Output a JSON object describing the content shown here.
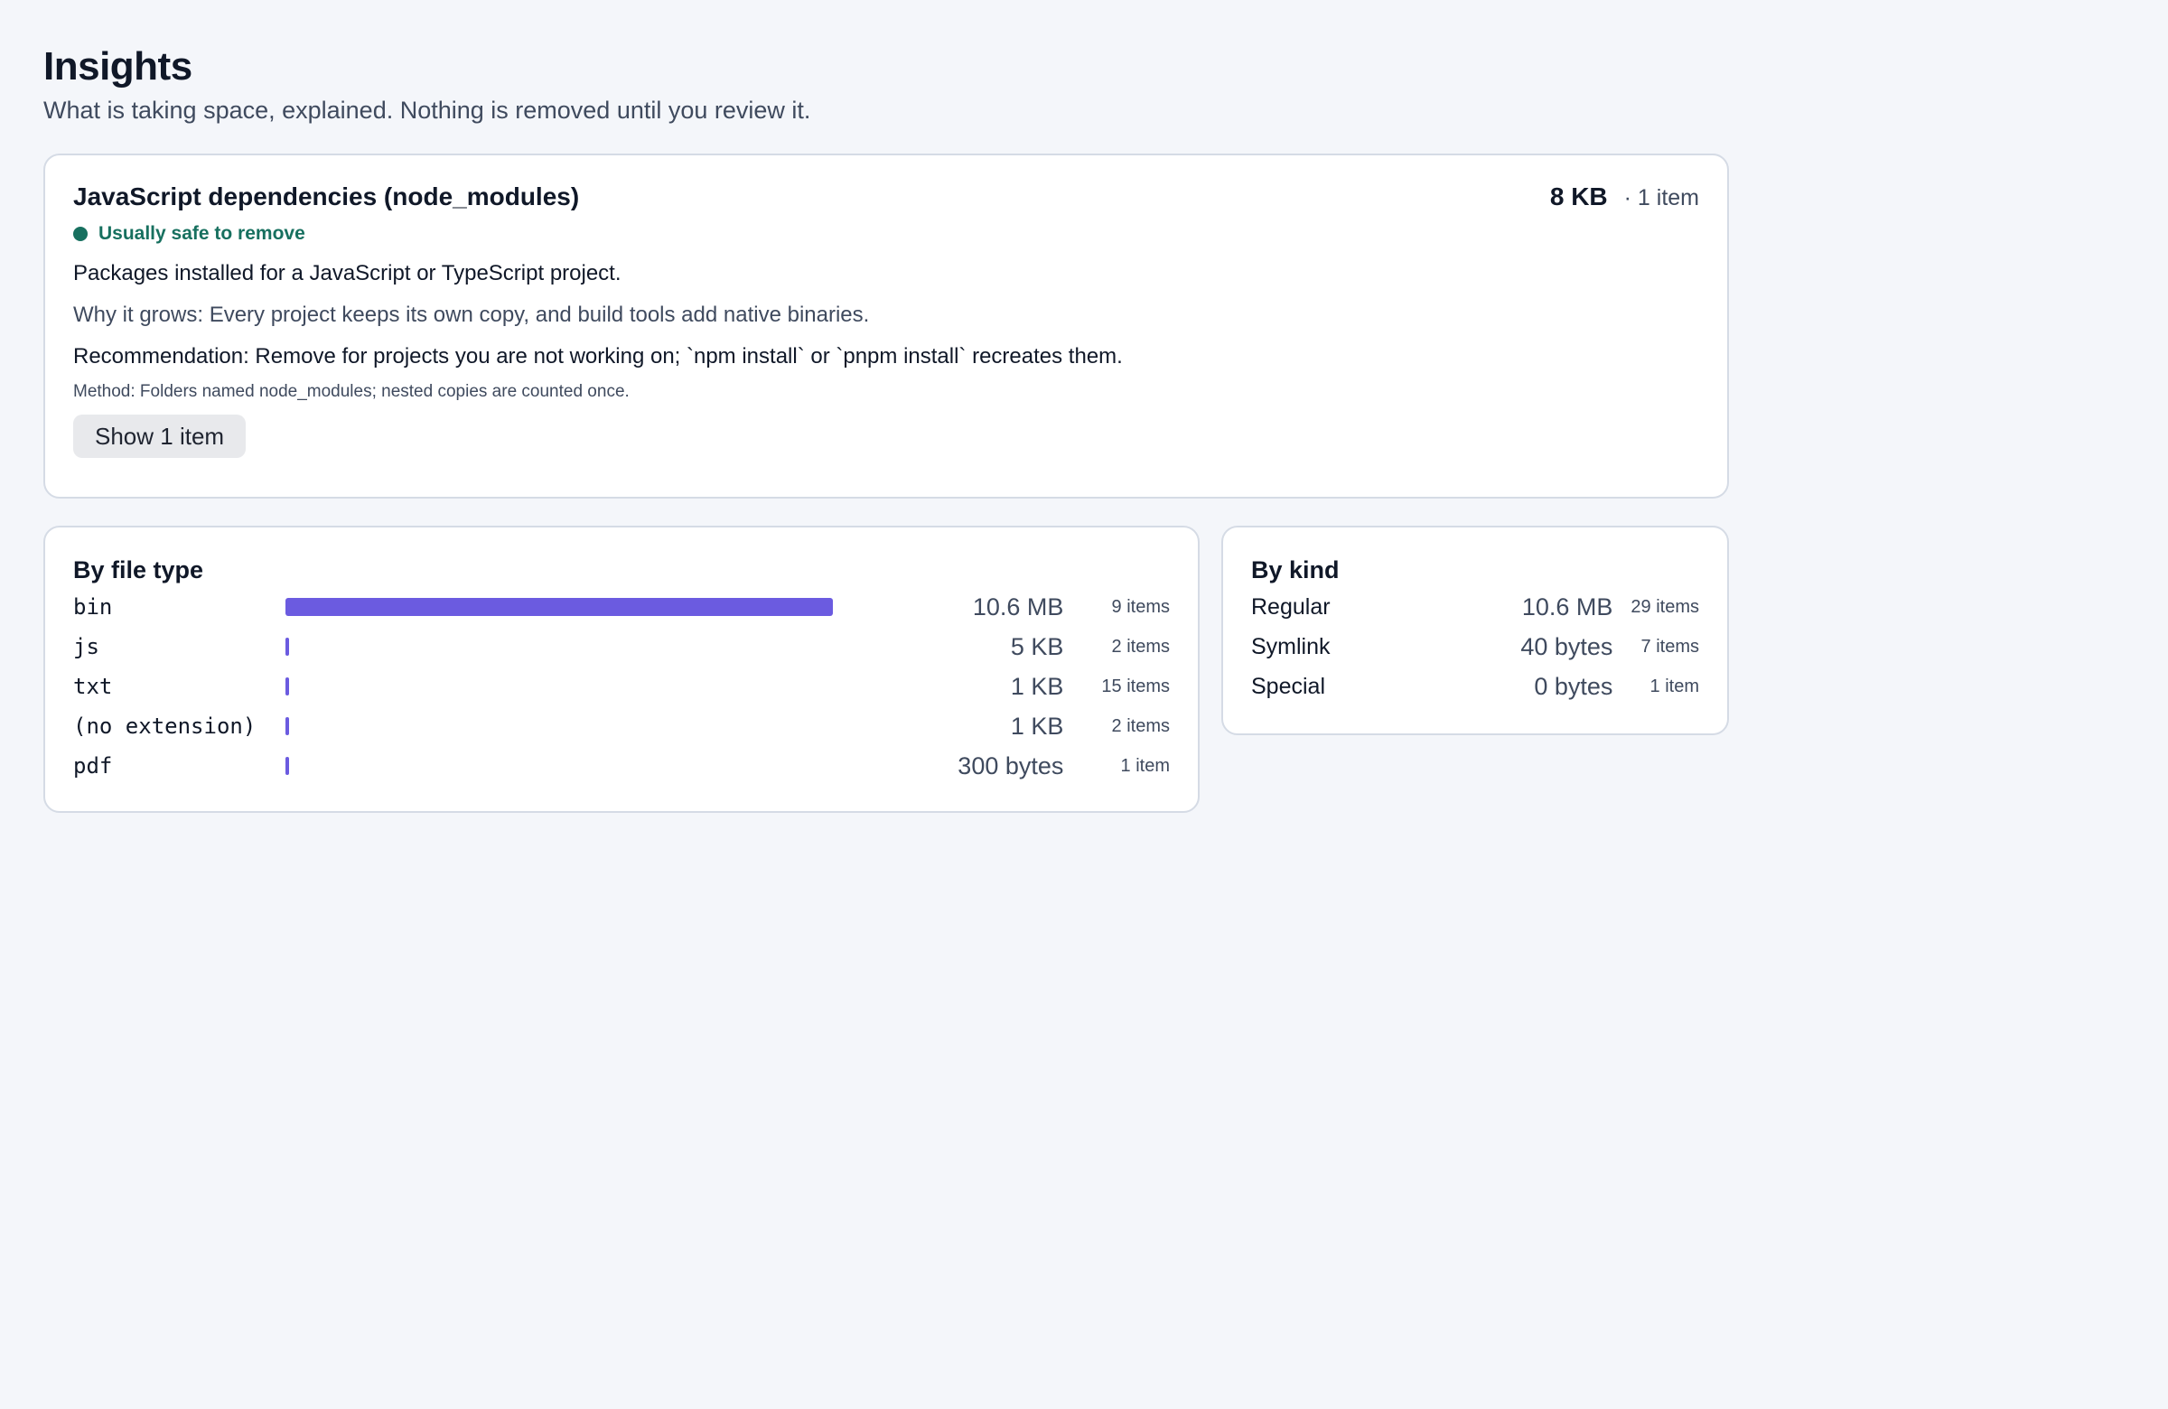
{
  "header": {
    "title": "Insights",
    "subtitle": "What is taking space, explained. Nothing is removed until you review it."
  },
  "insight": {
    "title": "JavaScript dependencies (node_modules)",
    "size": "8 KB",
    "count": "· 1 item",
    "safety": "Usually safe to remove",
    "safety_color": "#17705f",
    "description": "Packages installed for a JavaScript or TypeScript project.",
    "why": "Why it grows: Every project keeps its own copy, and build tools add native binaries.",
    "recommendation": "Recommendation: Remove for projects you are not working on; `npm install` or `pnpm install` recreates them.",
    "method": "Method: Folders named node_modules; nested copies are counted once.",
    "button_label": "Show 1 item"
  },
  "by_file_type": {
    "title": "By file type",
    "bar_color": "#6b5be0",
    "rows": [
      {
        "name": "bin",
        "size": "10.6 MB",
        "count": "9 items",
        "fraction": 0.996
      },
      {
        "name": "js",
        "size": "5 KB",
        "count": "2 items",
        "fraction": 0.0005
      },
      {
        "name": "txt",
        "size": "1 KB",
        "count": "15 items",
        "fraction": 0.0001
      },
      {
        "name": "(no extension)",
        "size": "1 KB",
        "count": "2 items",
        "fraction": 0.0001
      },
      {
        "name": "pdf",
        "size": "300 bytes",
        "count": "1 item",
        "fraction": 3e-05
      }
    ]
  },
  "by_kind": {
    "title": "By kind",
    "rows": [
      {
        "name": "Regular",
        "size": "10.6 MB",
        "count": "29 items"
      },
      {
        "name": "Symlink",
        "size": "40 bytes",
        "count": "7 items"
      },
      {
        "name": "Special",
        "size": "0 bytes",
        "count": "1 item"
      }
    ]
  }
}
